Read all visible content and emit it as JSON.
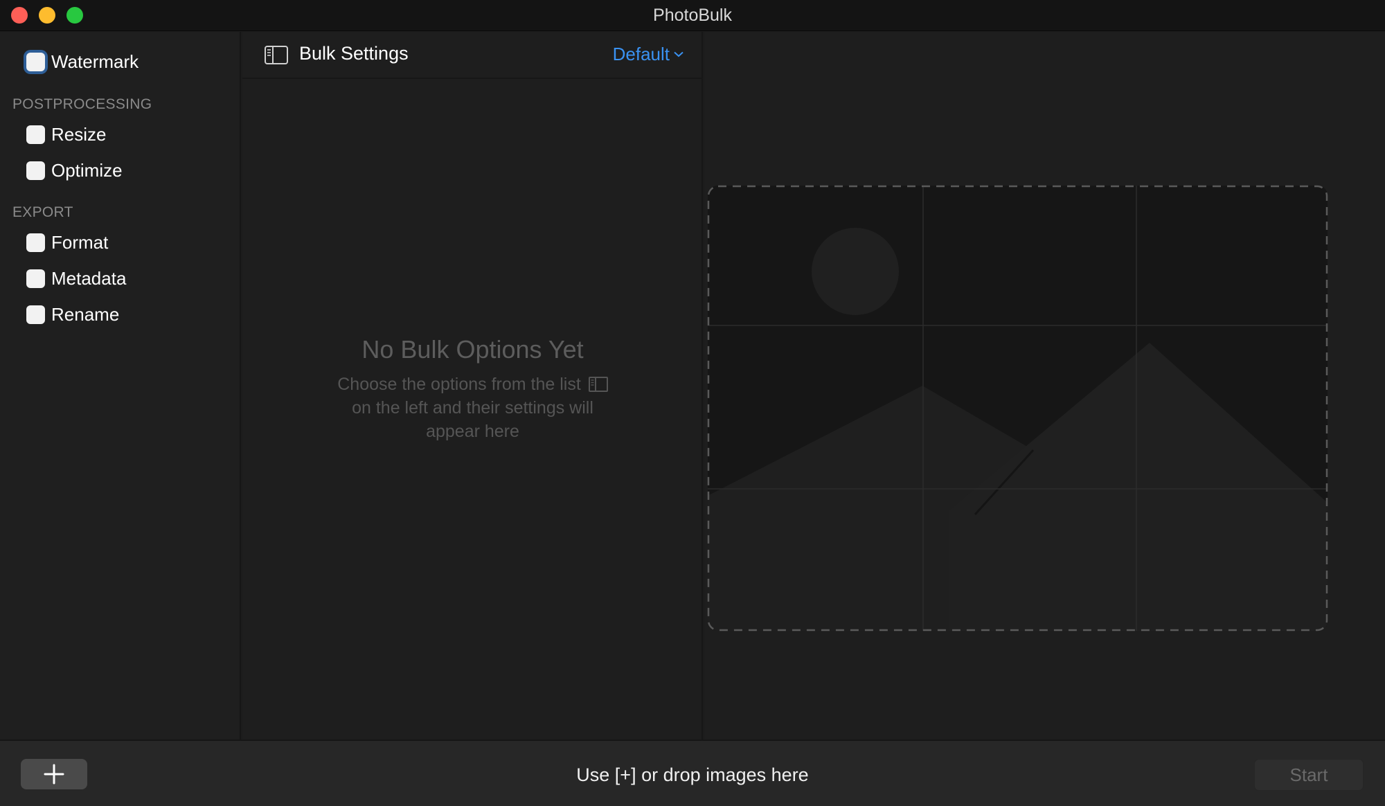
{
  "window": {
    "title": "PhotoBulk",
    "controls": [
      "close",
      "minimize",
      "maximize"
    ]
  },
  "sidebar": {
    "top_options": [
      {
        "label": "Watermark",
        "checked": false,
        "focused": true
      }
    ],
    "sections": [
      {
        "label": "POSTPROCESSING",
        "options": [
          {
            "label": "Resize",
            "checked": false
          },
          {
            "label": "Optimize",
            "checked": false
          }
        ]
      },
      {
        "label": "EXPORT",
        "options": [
          {
            "label": "Format",
            "checked": false
          },
          {
            "label": "Metadata",
            "checked": false
          },
          {
            "label": "Rename",
            "checked": false
          }
        ]
      }
    ]
  },
  "settings_panel": {
    "icon": "sidebar-panel-icon",
    "title": "Bulk Settings",
    "preset": "Default",
    "preset_icon": "chevron-down-icon",
    "empty_title": "No Bulk Options Yet",
    "empty_line1": "Choose the options from the list",
    "empty_line2": "on the left and their settings will",
    "empty_line3": "appear here"
  },
  "drop_area": {
    "icon": "image-placeholder-icon"
  },
  "footer": {
    "add_icon": "plus-icon",
    "hint": "Use [+] or drop images here",
    "start_label": "Start",
    "start_enabled": false
  },
  "colors": {
    "accent": "#3a92f2",
    "close": "#fe5f57",
    "minimize": "#febc2e",
    "maximize": "#28c840",
    "focus_ring": "#2e5e97"
  }
}
